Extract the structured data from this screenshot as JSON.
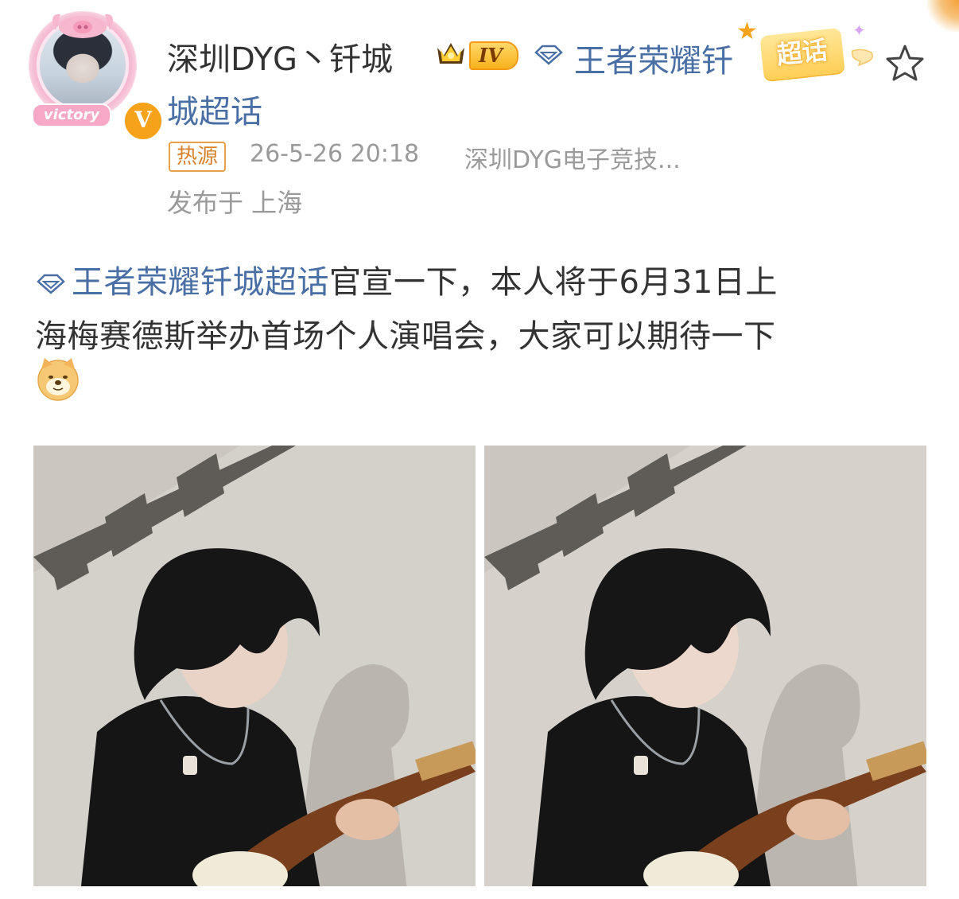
{
  "post": {
    "username": "深圳DYG丶钎城",
    "level": "IV",
    "topic_line1": "王者荣耀钎",
    "topic_line2": "城超话",
    "chaohua_label": "超话",
    "hot_label": "热源",
    "time": "26-5-26 20:18",
    "source": "深圳DYG电子竞技...",
    "location": "发布于 上海",
    "avatar_text": "victory",
    "verified_mark": "V",
    "body_topic": "王者荣耀钎城超话",
    "body_line1_rest": "官宣一下，本人将于6月31日上",
    "body_line2": "海梅赛德斯举办首场个人演唱会，大家可以期待一下",
    "emoji": "doge-emoji"
  },
  "icons": {
    "crown": "crown-icon",
    "topic": "diamond-topic-icon",
    "favorite": "star-outline-icon"
  },
  "colors": {
    "link": "#4a6fa5",
    "text": "#333333",
    "meta": "#9a9a9a",
    "hot": "#d9822b",
    "badge_orange": "#f7a21b"
  },
  "images": [
    {
      "description": "guitar-photo-1"
    },
    {
      "description": "guitar-photo-2"
    }
  ]
}
